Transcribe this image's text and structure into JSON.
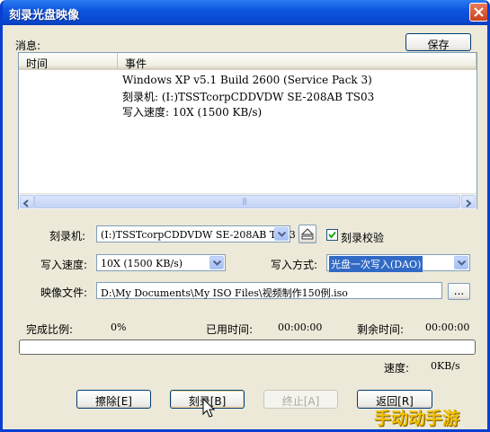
{
  "window": {
    "title": "刻录光盘映像",
    "close_label": "×"
  },
  "messages": {
    "label": "消息:",
    "save_label": "保存",
    "columns": [
      "时间",
      "事件"
    ],
    "lines": [
      "Windows XP v5.1 Build 2600 (Service Pack 3)",
      "刻录机: (I:)TSSTcorpCDDVDW SE-208AB TS03",
      "写入速度: 10X (1500 KB/s)"
    ],
    "scroll_thumb_grip": "|||"
  },
  "form": {
    "burner_label": "刻录机:",
    "burner_value": "(I:)TSSTcorpCDDVDW SE-208AB TS03",
    "verify_label": "刻录校验",
    "verify_checked": true,
    "speed_label": "写入速度:",
    "speed_value": "10X (1500 KB/s)",
    "mode_label": "写入方式:",
    "mode_value": "光盘一次写入(DAO)",
    "image_label": "映像文件:",
    "image_value": "D:\\My Documents\\My ISO Files\\视频制作150例.iso",
    "browse_label": "..."
  },
  "status": {
    "percent_label": "完成比例:",
    "percent_value": "0%",
    "elapsed_label": "已用时间:",
    "elapsed_value": "00:00:00",
    "remaining_label": "剩余时间:",
    "remaining_value": "00:00:00",
    "progress": 0,
    "speed_label": "速度:",
    "speed_value": "0KB/s"
  },
  "buttons": {
    "erase": "擦除[E]",
    "burn": "刻录[B]",
    "abort": "终止[A]",
    "back": "返回[R]"
  },
  "watermark": "手动动手游",
  "colors": {
    "title_bar": "#0a48d0",
    "dialog_bg": "#ece9d8",
    "selection": "#316ac5",
    "progress": "#2db83d"
  }
}
